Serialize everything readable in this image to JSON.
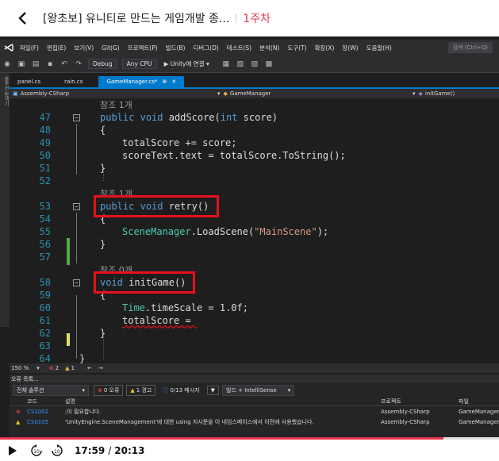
{
  "header": {
    "title": "[왕초보] 유니티로 만드는 게임개발 종...",
    "week": "1주차"
  },
  "menu": {
    "items": [
      "파일(F)",
      "편집(E)",
      "보기(V)",
      "Git(G)",
      "프로젝트(P)",
      "빌드(B)",
      "디버그(D)",
      "테스트(S)",
      "분석(N)",
      "도구(T)",
      "확장(X)",
      "창(W)",
      "도움말(H)"
    ],
    "search": "검색 (Ctrl+Q)"
  },
  "toolbar": {
    "config": "Debug",
    "platform": "Any CPU",
    "attach": "▶ Unity에 연결 ▾"
  },
  "side_strip": "솔루션 탐색기",
  "tabs": [
    {
      "label": "panel.cs"
    },
    {
      "label": "rain.cs"
    },
    {
      "label": "GameManager.cs*"
    }
  ],
  "nav": {
    "project": "Assembly-CSharp",
    "class": "GameManager",
    "member": "initGame()"
  },
  "code": {
    "ref1": "참조 1개",
    "ref2": "참조 1개",
    "ref3": "참조 0개",
    "lines": [
      {
        "n": "47",
        "t": "addScore"
      },
      {
        "n": "48",
        "t": "{"
      },
      {
        "n": "49",
        "t": "totalScore += score;"
      },
      {
        "n": "50",
        "t": "scoreText.text = totalScore.ToString();"
      },
      {
        "n": "51",
        "t": "}"
      },
      {
        "n": "52",
        "t": ""
      },
      {
        "n": "53",
        "t": "retry"
      },
      {
        "n": "54",
        "t": "{"
      },
      {
        "n": "55",
        "t": "LoadScene"
      },
      {
        "n": "56",
        "t": "}"
      },
      {
        "n": "57",
        "t": ""
      },
      {
        "n": "58",
        "t": "initGame"
      },
      {
        "n": "59",
        "t": "{"
      },
      {
        "n": "60",
        "t": "timeScale"
      },
      {
        "n": "61",
        "t": "totalScore = "
      },
      {
        "n": "62",
        "t": "}"
      },
      {
        "n": "63",
        "t": ""
      },
      {
        "n": "64",
        "t": "}"
      }
    ]
  },
  "editor_status": {
    "zoom": "150 %",
    "errors": "2",
    "warnings": "1"
  },
  "error_list": {
    "title": "오류 목록...",
    "scope": "전체 솔루션",
    "errors_btn": "0 오류",
    "warnings_btn": "1 경고",
    "messages_btn": "0/13 메시지",
    "build_combo": "빌드 + IntelliSense",
    "col_code": "코드",
    "col_desc": "설명",
    "col_project": "프로젝트",
    "col_file": "파일",
    "rows": [
      {
        "code": "CS1002",
        "desc": ";이 필요합니다.",
        "project": "Assembly-CSharp",
        "file": "GameManager"
      },
      {
        "code": "CS0105",
        "desc": "'UnityEngine.SceneManagement'에 대한 using 지시문을 이 네임스페이스에서 이전에 사용했습니다.",
        "project": "Assembly-CSharp",
        "file": "GameManager"
      }
    ]
  },
  "player": {
    "current": "17:59",
    "separator": "/",
    "total": "20:13",
    "progress": 0.889
  },
  "colors": {
    "accent": "#e8344e",
    "vs_blue": "#007acc",
    "highlight_red": "#e8101c"
  }
}
